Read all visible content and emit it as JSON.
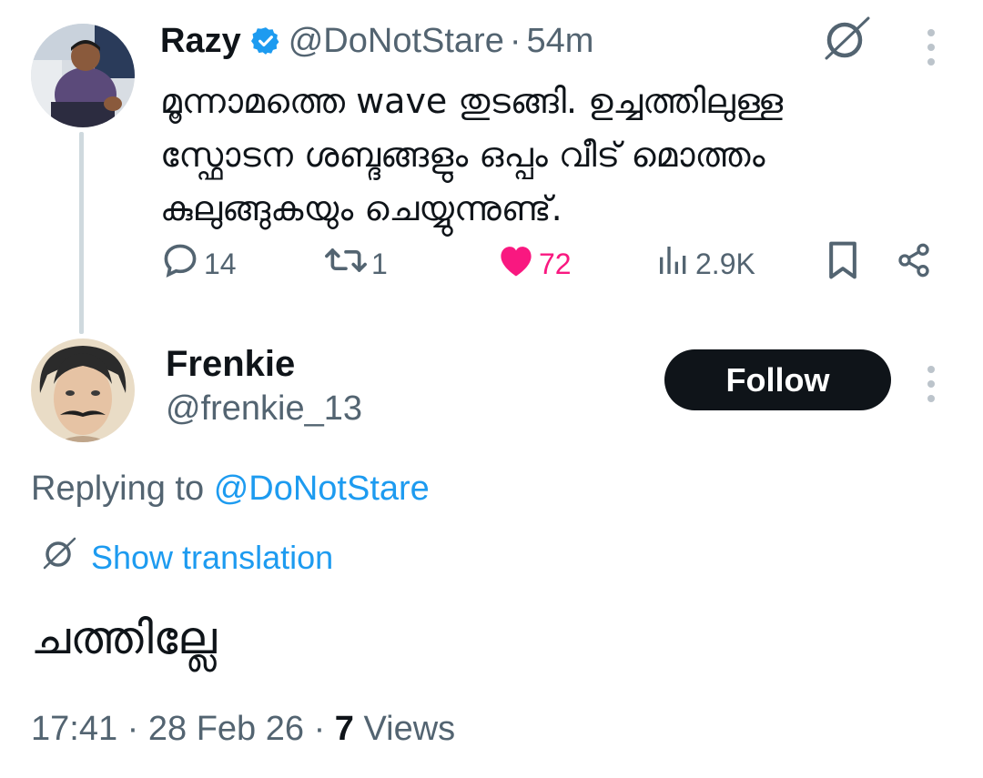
{
  "parent_tweet": {
    "author_name": "Razy",
    "handle": "@DoNotStare",
    "separator": "·",
    "time_ago": "54m",
    "text_lines": [
      "മൂന്നാമത്തെ wave തുടങ്ങി. ഉച്ചത്തിലുള്ള",
      "സ്ഫോടന ശബ്ദങ്ങളും ഒപ്പം വീട് മൊത്തം",
      "കുലുങ്ങുകയും ചെയ്യുന്നുണ്ട്."
    ],
    "icons": {
      "verified": "verified-badge-icon",
      "translate": "no-translate-icon",
      "more": "more-vertical-icon"
    },
    "actions": {
      "replies": "14",
      "retweets": "1",
      "likes": "72",
      "views": "2.9K"
    }
  },
  "reply_tweet": {
    "author_name": "Frenkie",
    "handle": "@frenkie_13",
    "follow_label": "Follow",
    "replying_prefix": "Replying to",
    "replying_handle": "@DoNotStare",
    "show_translation": "Show translation",
    "text": "ചത്തില്ലേ",
    "time": "17:41",
    "separator": "·",
    "date": "28 Feb 26",
    "views_count": "7",
    "views_label": "Views"
  },
  "colors": {
    "text_primary": "#0f1419",
    "text_secondary": "#536471",
    "link": "#1d9bf0",
    "like": "#f91880",
    "verified": "#1d9bf0",
    "follow_bg": "#0f1419"
  }
}
